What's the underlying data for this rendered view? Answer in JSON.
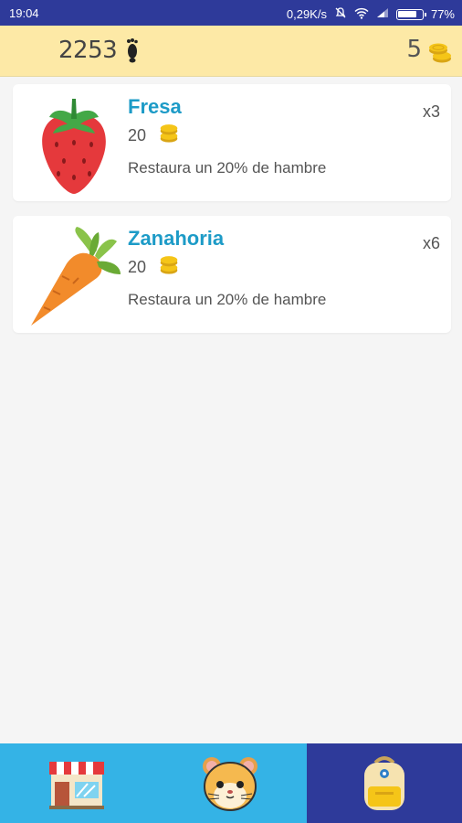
{
  "statusbar": {
    "time": "19:04",
    "net_speed": "0,29K/s",
    "battery": "77%"
  },
  "header": {
    "steps": "2253",
    "coins": "5"
  },
  "items": [
    {
      "name": "Fresa",
      "price": "20",
      "description": "Restaura un 20% de hambre",
      "quantity": "x3",
      "icon": "strawberry-icon"
    },
    {
      "name": "Zanahoria",
      "price": "20",
      "description": "Restaura un 20% de hambre",
      "quantity": "x6",
      "icon": "carrot-icon"
    }
  ],
  "nav": {
    "tabs": [
      "shop-icon",
      "hamster-icon",
      "backpack-icon"
    ],
    "active_tab": 2
  },
  "colors": {
    "statusbar": "#2e3a9a",
    "header": "#fde9a6",
    "title": "#1d9bc7",
    "nav": "#34b3e6",
    "nav_active": "#2e3a9a"
  }
}
